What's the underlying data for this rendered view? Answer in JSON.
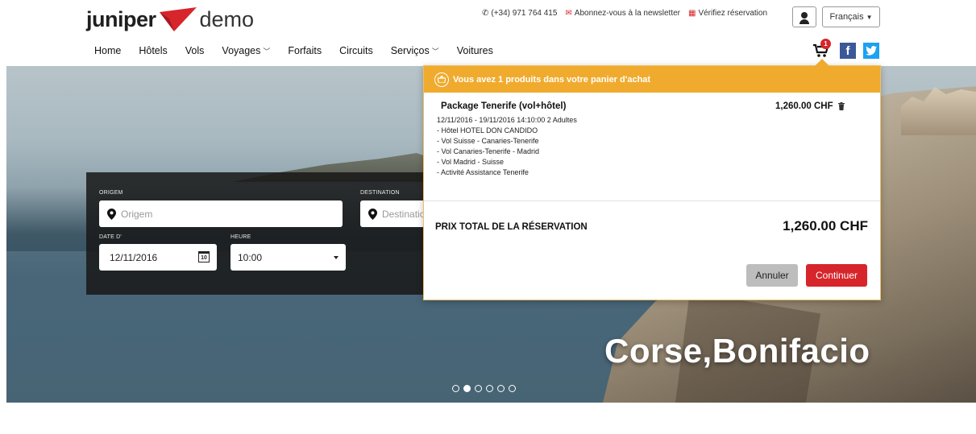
{
  "header": {
    "logo_brand": "juniper",
    "logo_suffix": "demo",
    "phone": "(+34) 971 764 415",
    "newsletter": "Abonnez-vous à la newsletter",
    "reservation": "Vérifiez réservation",
    "language": "Français",
    "cart_count": "1",
    "facebook": "f"
  },
  "nav": {
    "items": [
      {
        "label": "Home"
      },
      {
        "label": "Hôtels"
      },
      {
        "label": "Vols"
      },
      {
        "label": "Voyages"
      },
      {
        "label": "Forfaits"
      },
      {
        "label": "Circuits"
      },
      {
        "label": "Serviços"
      },
      {
        "label": "Voitures"
      }
    ]
  },
  "search": {
    "origin_label": "ORIGEM",
    "origin_placeholder": "Origem",
    "destination_label": "DESTINATION",
    "destination_placeholder": "Destination",
    "date_label": "DATE D'",
    "date_value": "12/11/2016",
    "time_label": "HEURE",
    "time_value": "10:00"
  },
  "hero": {
    "headline": "Corse,Bonifacio",
    "slides_total": 6,
    "active_slide": 2
  },
  "cart_popup": {
    "header": "Vous avez 1 produits dans votre panier d'achat",
    "item_title": "Package Tenerife (vol+hôtel)",
    "item_price": "1,260.00 CHF",
    "item_lines": [
      "12/11/2016 - 19/11/2016 14:10:00 2 Adultes",
      "- Hôtel HOTEL DON CANDIDO",
      "- Vol Suisse - Canaries-Tenerife",
      "- Vol Canaries-Tenerife - Madrid",
      "- Vol Madrid - Suisse",
      "- Activité Assistance Tenerife"
    ],
    "total_label": "PRIX TOTAL DE LA RÉSERVATION",
    "total_value": "1,260.00 CHF",
    "cancel_label": "Annuler",
    "continue_label": "Continuer"
  },
  "colors": {
    "accent_orange": "#f0ab2e",
    "brand_red": "#d6252b",
    "facebook": "#3b5998",
    "twitter": "#1da1f2"
  },
  "icons": [
    "phone-icon",
    "mail-icon",
    "reservation-icon",
    "user-icon",
    "cart-icon",
    "facebook-icon",
    "twitter-icon",
    "location-pin-icon",
    "calendar-icon",
    "trash-icon",
    "basket-icon"
  ]
}
